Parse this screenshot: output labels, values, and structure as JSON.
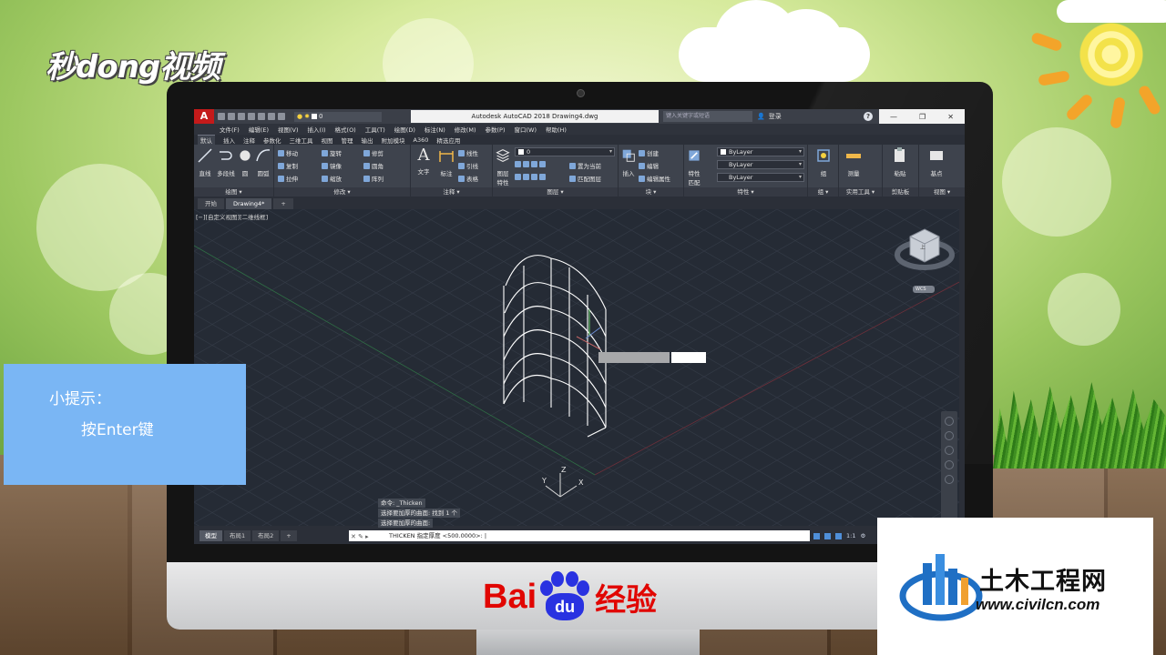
{
  "brand": {
    "miaodong": "秒dong视频",
    "baidu_left": "Bai",
    "baidu_paw": "du",
    "baidu_right": "经验",
    "civil_cn": "土木工程网",
    "civil_url": "www.civilcn.com"
  },
  "tip": {
    "title": "小提示：",
    "body": "按Enter键"
  },
  "titlebar": {
    "app_logo": "A",
    "layer_value": "0",
    "title": "Autodesk AutoCAD 2018    Drawing4.dwg",
    "search_placeholder": "键入关键字或短语",
    "login": "登录",
    "help": "?",
    "win_min": "—",
    "win_max": "❐",
    "win_close": "✕"
  },
  "menubar": [
    "文件(F)",
    "编辑(E)",
    "视图(V)",
    "插入(I)",
    "格式(O)",
    "工具(T)",
    "绘图(D)",
    "标注(N)",
    "修改(M)",
    "参数(P)",
    "窗口(W)",
    "帮助(H)"
  ],
  "ribbon_tabs": [
    "默认",
    "插入",
    "注释",
    "参数化",
    "三维工具",
    "视图",
    "管理",
    "输出",
    "附加模块",
    "A360",
    "精选应用"
  ],
  "ribbon": {
    "draw": {
      "label": "绘图 ▾",
      "line": "直线",
      "polyline": "多段线",
      "circle": "圆",
      "arc": "圆弧"
    },
    "modify": {
      "label": "修改 ▾",
      "move": "移动",
      "rotate": "旋转",
      "trim": "修剪",
      "copy": "复制",
      "mirror": "镜像",
      "fillet": "圆角",
      "stretch": "拉伸",
      "scale": "缩放",
      "array": "阵列"
    },
    "annotation": {
      "label": "注释 ▾",
      "text": "文字",
      "dimension": "标注",
      "linear": "线性",
      "leader": "引线",
      "table": "表格"
    },
    "layers": {
      "label": "图层 ▾",
      "layer_props": "图层特性",
      "layer_value": "0",
      "set_current": "置为当前",
      "match_layer": "匹配图层"
    },
    "block": {
      "label": "块 ▾",
      "insert": "插入",
      "create": "创建",
      "edit": "编辑",
      "edit_attr": "编辑属性"
    },
    "properties": {
      "label": "特性 ▾",
      "match": "特性匹配",
      "color": "ByLayer",
      "linetype": "ByLayer",
      "lineweight": "ByLayer"
    },
    "groups": {
      "label": "组 ▾",
      "group": "组"
    },
    "utilities": {
      "label": "实用工具 ▾",
      "measure": "测量"
    },
    "clipboard": {
      "label": "剪贴板",
      "paste": "粘贴"
    },
    "view": {
      "label": "视图 ▾",
      "base": "基点"
    }
  },
  "file_tabs": {
    "start": "开始",
    "current": "Drawing4*",
    "add": "+"
  },
  "viewport": {
    "label": "[−][自定义视图][二维线框]",
    "wcs": "WCS",
    "axis_x": "X",
    "axis_y": "Y",
    "axis_z": "Z",
    "cube_face": "上"
  },
  "command": {
    "history": [
      "命令: _Thicken",
      "选择要加厚的曲面: 找到 1 个",
      "选择要加厚的曲面:"
    ],
    "prompt": "THICKEN 指定厚度 <500.0000>:",
    "cursor": "|"
  },
  "layout_tabs": [
    "模型",
    "布局1",
    "布局2",
    "+"
  ],
  "status": {
    "scale": "1:1",
    "gear": "⚙"
  }
}
